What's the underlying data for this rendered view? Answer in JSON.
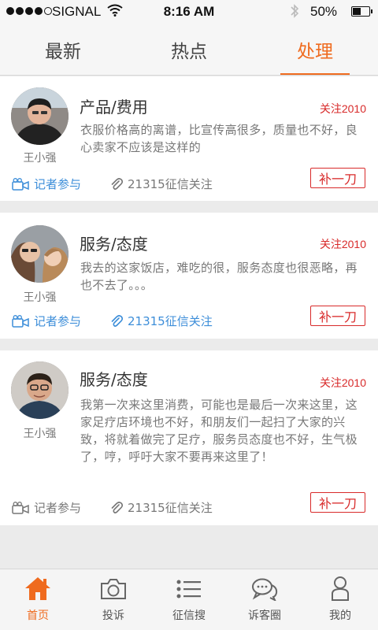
{
  "status_bar": {
    "carrier": "SIGNAL",
    "time": "8:16 AM",
    "battery": "50%",
    "battery_level": 0.5
  },
  "tabs": [
    {
      "label": "最新",
      "active": false
    },
    {
      "label": "热点",
      "active": false
    },
    {
      "label": "处理",
      "active": true
    }
  ],
  "posts": [
    {
      "author": "王小强",
      "title": "产品/费用",
      "follow": "关注2010",
      "content": "衣服价格高的离谱，比宣传高很多，质量也不好，良心卖家不应该是这样的",
      "reporter": "记者参与",
      "watch": "21315征信关注",
      "button": "补一刀",
      "reporter_active": true,
      "watch_active": false
    },
    {
      "author": "王小强",
      "title": "服务/态度",
      "follow": "关注2010",
      "content": "我去的这家饭店，难吃的很，服务态度也很恶略，再也不去了。。。",
      "reporter": "记者参与",
      "watch": "21315征信关注",
      "button": "补一刀",
      "reporter_active": true,
      "watch_active": true
    },
    {
      "author": "王小强",
      "title": "服务/态度",
      "follow": "关注2010",
      "content": "我第一次来这里消费，可能也是最后一次来这里，这家足疗店环境也不好，和朋友们一起扫了大家的兴致，将就着做完了足疗，服务员态度也不好，生气极了，哼，呼吁大家不要再来这里了！",
      "reporter": "记者参与",
      "watch": "21315征信关注",
      "button": "补一刀",
      "reporter_active": false,
      "watch_active": false
    }
  ],
  "nav": [
    {
      "label": "首页",
      "icon": "home-icon",
      "active": true
    },
    {
      "label": "投诉",
      "icon": "camera-icon",
      "active": false
    },
    {
      "label": "征信搜",
      "icon": "list-icon",
      "active": false
    },
    {
      "label": "诉客圈",
      "icon": "chat-icon",
      "active": false
    },
    {
      "label": "我的",
      "icon": "user-icon",
      "active": false
    }
  ],
  "colors": {
    "accent": "#ef6b1f",
    "alert": "#d82a2a",
    "link": "#3d8ed9"
  }
}
